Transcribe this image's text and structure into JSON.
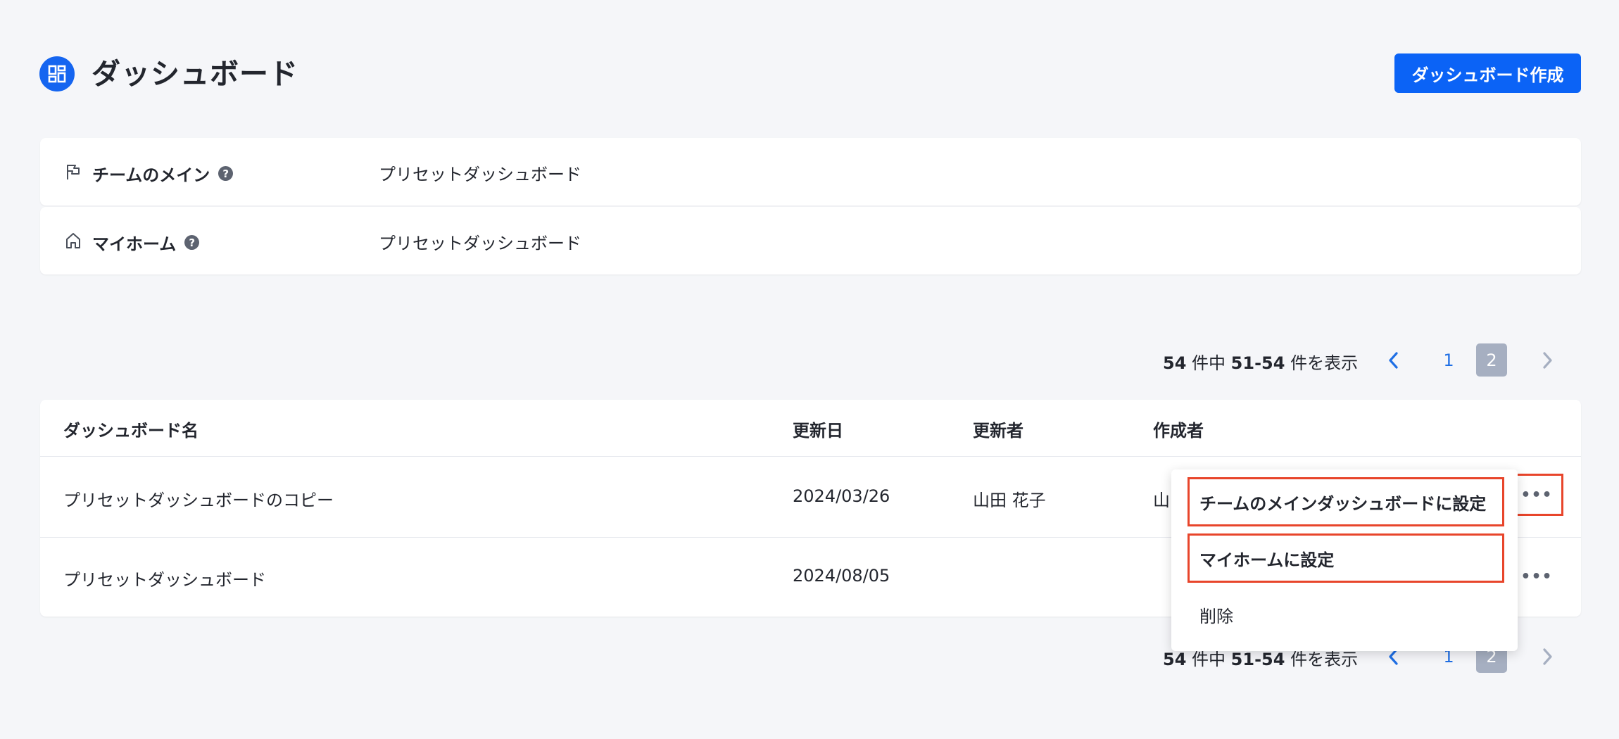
{
  "header": {
    "title": "ダッシュボード",
    "create_button": "ダッシュボード作成"
  },
  "settings": [
    {
      "icon": "flag-icon",
      "label": "チームのメイン",
      "help": "?",
      "value": "プリセットダッシュボード"
    },
    {
      "icon": "home-icon",
      "label": "マイホーム",
      "help": "?",
      "value": "プリセットダッシュボード"
    }
  ],
  "pagination": {
    "total": "54",
    "total_suffix": " 件中 ",
    "range": "51-54",
    "range_suffix": " 件を表示",
    "pages": [
      "1",
      "2"
    ],
    "current": "2"
  },
  "table": {
    "columns": [
      "ダッシュボード名",
      "更新日",
      "更新者",
      "作成者"
    ],
    "rows": [
      {
        "name": "プリセットダッシュボードのコピー",
        "updated": "2024/03/26",
        "updater": "山田 花子",
        "creator": "山"
      },
      {
        "name": "プリセットダッシュボード",
        "updated": "2024/08/05",
        "updater": "",
        "creator": ""
      }
    ],
    "more_label": "•••"
  },
  "menu": {
    "items": [
      "チームのメインダッシュボードに設定",
      "マイホームに設定",
      "削除"
    ]
  },
  "colors": {
    "primary": "#0b63f6",
    "highlight": "#e8452b",
    "current_page": "#a6afc1",
    "link": "#1f6fe5"
  }
}
